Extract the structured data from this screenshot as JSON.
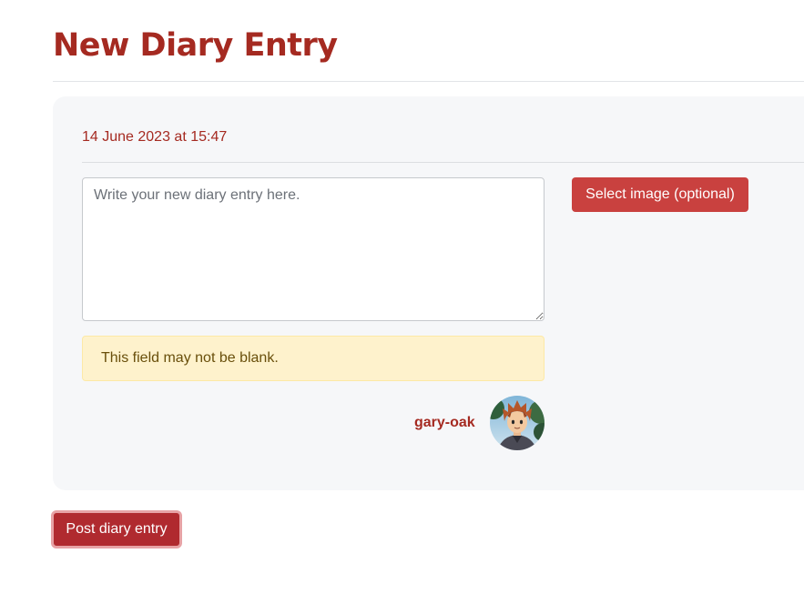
{
  "page": {
    "title": "New Diary Entry"
  },
  "form": {
    "timestamp": "14 June 2023 at 15:47",
    "content_placeholder": "Write your new diary entry here.",
    "content_value": "",
    "select_image_label": "Select image (optional)",
    "error_message": "This field may not be blank."
  },
  "author": {
    "username": "gary-oak",
    "avatar_icon": "user-avatar"
  },
  "actions": {
    "post_label": "Post diary entry"
  },
  "colors": {
    "brand": "#a52a21",
    "button": "#c9413f",
    "post_button": "#b02a2f",
    "alert_bg": "#fef2cc",
    "alert_text": "#694f0b",
    "card_bg": "#f6f7f9"
  }
}
